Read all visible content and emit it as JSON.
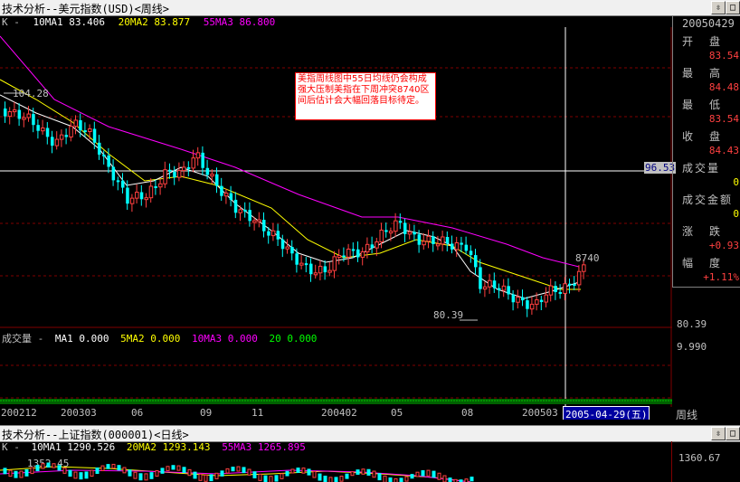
{
  "window1": {
    "title": "技术分析--美元指数(USD)<周线>",
    "ma_line": {
      "prefix": "K -",
      "ma1": "10MA1  83.406",
      "ma2": "20MA2  83.877",
      "ma3": "55MA3  86.800"
    },
    "vol_line": {
      "prefix": "成交量 -",
      "ma1": "MA1  0.000",
      "ma2": "5MA2  0.000",
      "ma3": "10MA3  0.000",
      "ma4": "20  0.000"
    },
    "price_labels": {
      "high_marker": "104.28",
      "low_marker": "80.39",
      "target": "8740",
      "crosshair": "96.53",
      "axis_low": "80.39",
      "vol_axis": "9.990"
    },
    "annotation": "美指周线图中55日均线仍会构成强大压制美指在下周冲突8740区间后估计会大幅回落目标待定。",
    "x_axis": [
      "200212",
      "200303",
      "06",
      "09",
      "11",
      "200402",
      "05",
      "08",
      "200503"
    ],
    "cursor_date": "2005-04-29(五)",
    "period": "周线"
  },
  "side_panel": {
    "date": "20050429",
    "rows": [
      {
        "label": "开盘",
        "value": "83.54",
        "color": "#ff4040"
      },
      {
        "label": "最高",
        "value": "84.48",
        "color": "#ff4040"
      },
      {
        "label": "最低",
        "value": "83.54",
        "color": "#ff4040"
      },
      {
        "label": "收盘",
        "value": "84.43",
        "color": "#ff4040"
      },
      {
        "label": "成交量",
        "value": "0",
        "color": "#ffff00"
      },
      {
        "label": "成交金额",
        "value": "0",
        "color": "#ffff00"
      },
      {
        "label": "涨跌",
        "value": "+0.93",
        "color": "#ff4040"
      },
      {
        "label": "幅度",
        "value": "+1.11%",
        "color": "#ff4040"
      }
    ]
  },
  "window2": {
    "title": "技术分析--上证指数(000001)<日线>",
    "ma_line": {
      "prefix": "K -",
      "ma1": "10MA1  1290.526",
      "ma2": "20MA2  1293.143",
      "ma3": "55MA3  1265.895"
    },
    "axis_top": "1360.67",
    "label_left": "1352.45"
  },
  "colors": {
    "ma1": "#ffffff",
    "ma2": "#ffff00",
    "ma3": "#ff00ff",
    "up": "#ff4040",
    "down": "#00ffff",
    "grid": "#800000"
  }
}
